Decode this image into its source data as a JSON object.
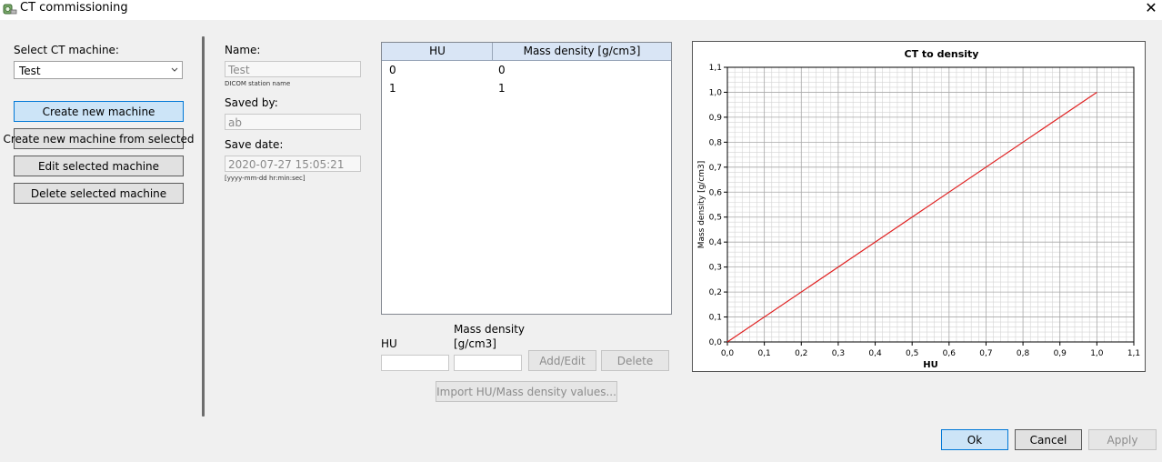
{
  "window": {
    "title": "CT commissioning",
    "close_glyph": "✕"
  },
  "left_panel": {
    "select_label": "Select CT machine:",
    "selected_machine": "Test",
    "buttons": {
      "create_new": "Create new machine",
      "create_from_selected": "Create new machine from selected",
      "edit_selected": "Edit selected machine",
      "delete_selected": "Delete selected machine"
    }
  },
  "details": {
    "name_label": "Name:",
    "name_value": "Test",
    "name_hint": "DICOM station name",
    "saved_by_label": "Saved by:",
    "saved_by_value": "ab",
    "save_date_label": "Save date:",
    "save_date_value": "2020-07-27 15:05:21",
    "save_date_hint": "[yyyy-mm-dd hr:min:sec]"
  },
  "table": {
    "headers": [
      "HU",
      "Mass density [g/cm3]"
    ],
    "rows": [
      [
        "0",
        "0"
      ],
      [
        "1",
        "1"
      ]
    ]
  },
  "editor": {
    "hu_label": "HU",
    "mass_density_label_line1": "Mass density",
    "mass_density_label_line2": "[g/cm3]",
    "hu_value": "",
    "mass_density_value": "",
    "add_edit_label": "Add/Edit",
    "delete_label": "Delete",
    "import_label": "Import HU/Mass density values..."
  },
  "footer": {
    "ok_label": "Ok",
    "cancel_label": "Cancel",
    "apply_label": "Apply"
  },
  "icons": {
    "app": "ct-scanner-icon",
    "close": "close-icon",
    "dropdown": "chevron-down-icon"
  },
  "colors": {
    "line": "#e02020",
    "focus_button": "#cce4f7",
    "table_header": "#d9e5f5"
  },
  "chart_data": {
    "type": "line",
    "title": "CT to density",
    "xlabel": "HU",
    "ylabel": "Mass density [g/cm3]",
    "xlim": [
      0,
      1.1
    ],
    "ylim": [
      0,
      1.1
    ],
    "xticks": [
      "0,0",
      "0,1",
      "0,2",
      "0,3",
      "0,4",
      "0,5",
      "0,6",
      "0,7",
      "0,8",
      "0,9",
      "1,0",
      "1,1"
    ],
    "yticks": [
      "0,0",
      "0,1",
      "0,2",
      "0,3",
      "0,4",
      "0,5",
      "0,6",
      "0,7",
      "0,8",
      "0,9",
      "1,0",
      "1,1"
    ],
    "grid": true,
    "series": [
      {
        "x": [
          0,
          1
        ],
        "y": [
          0,
          1
        ]
      }
    ]
  }
}
